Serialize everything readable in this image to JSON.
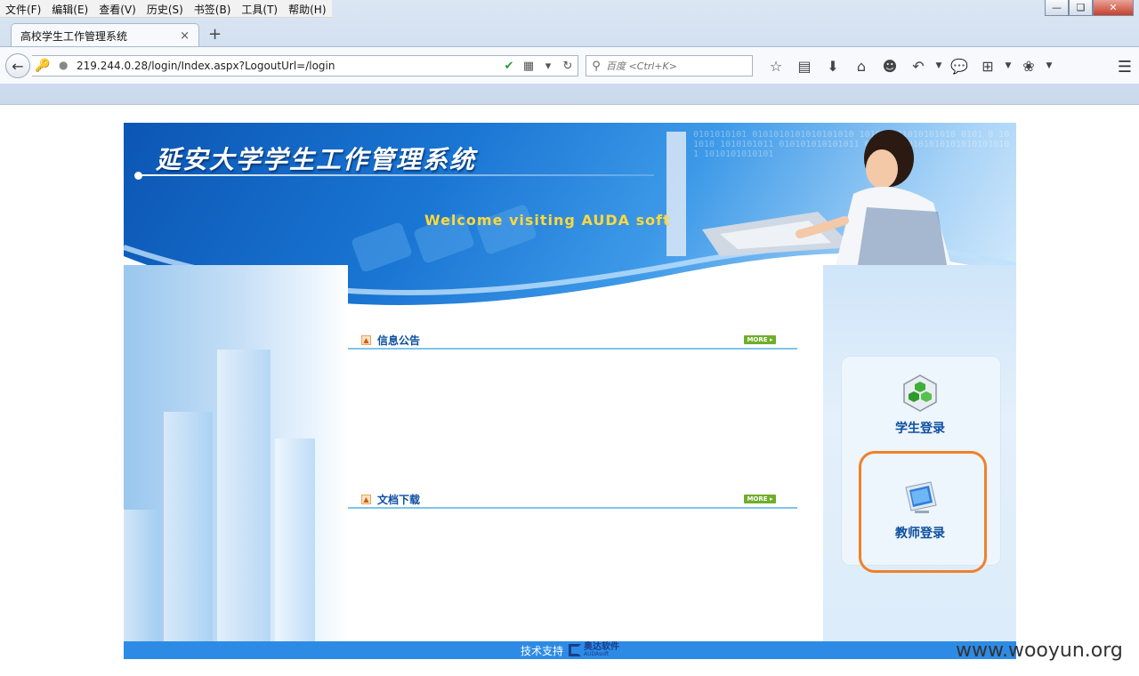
{
  "menubar": {
    "items": [
      "文件(F)",
      "编辑(E)",
      "查看(V)",
      "历史(S)",
      "书签(B)",
      "工具(T)",
      "帮助(H)"
    ]
  },
  "tab": {
    "title": "高校学生工作管理系统",
    "close_glyph": "×",
    "new_tab_glyph": "+"
  },
  "navbar": {
    "url": "219.244.0.28/login/Index.aspx?LogoutUrl=/login",
    "search_placeholder": "百度 <Ctrl+K>"
  },
  "icons": {
    "back": "back-arrow-icon",
    "key": "key-icon",
    "shield": "shield-icon",
    "qr": "qr-code-icon",
    "reload": "reload-icon",
    "search": "search-icon",
    "bookmark": "star-icon",
    "reader": "reader-icon",
    "download": "download-icon",
    "home": "home-icon",
    "chat": "chat-icon",
    "undo": "undo-icon",
    "comment": "comment-icon",
    "crop": "crop-icon",
    "addon": "addon-icon",
    "menu": "hamburger-menu-icon"
  },
  "banner": {
    "title": "延安大学学生工作管理系统",
    "welcome": "Welcome  visiting  AUDA soft",
    "binary": "0101010101 0101010101010101010 101010101010101010 0101 0 101010 1010101011 010101010101011 0101010101010101010101010101 1010101010101"
  },
  "sections": {
    "notice": {
      "title": "信息公告",
      "more": "MORE ▸"
    },
    "docs": {
      "title": "文档下载",
      "more": "MORE ▸"
    }
  },
  "login": {
    "student": "学生登录",
    "teacher": "教师登录"
  },
  "footer": {
    "text": "技术支持",
    "logo_text": "奥达软件",
    "logo_sub": "AUDAsoft"
  },
  "watermark": "www.wooyun.org",
  "colors": {
    "banner_blue": "#1a76d3",
    "title_blue": "#0d4fa0",
    "highlight_orange": "#f0802b",
    "footer_blue": "#2d8be6",
    "more_green": "#6fae2a"
  }
}
